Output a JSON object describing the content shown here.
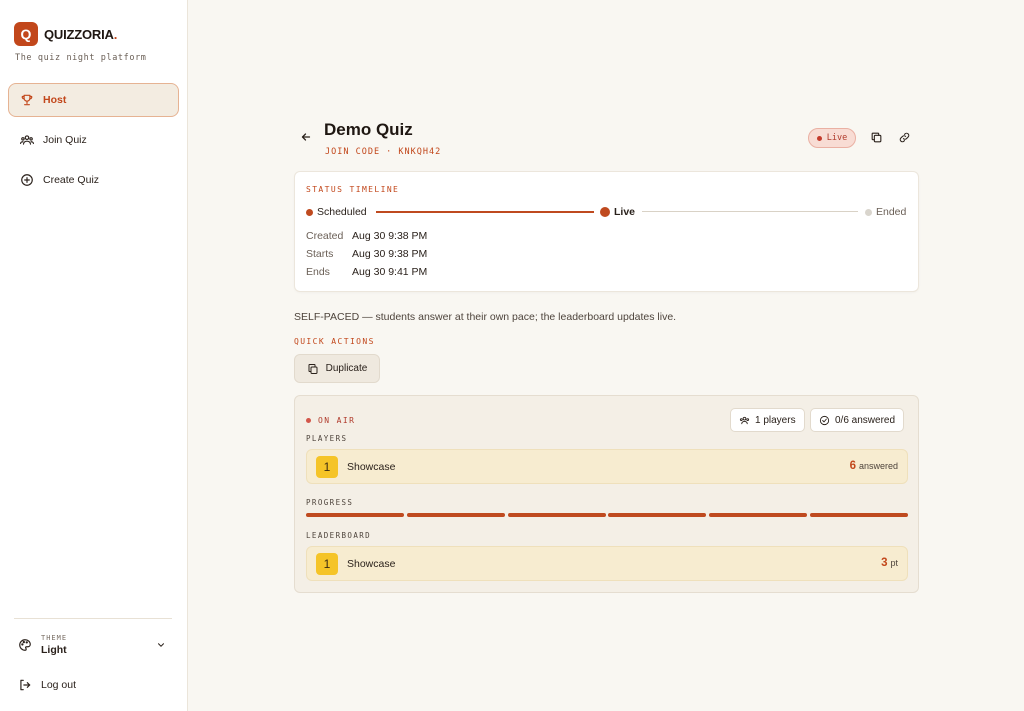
{
  "brand": {
    "logo_letter": "Q",
    "name": "QUIZZORIA",
    "dot": ".",
    "tagline": "The quiz night platform",
    "color": "#c2471b"
  },
  "nav": {
    "items": [
      {
        "label": "Host",
        "icon": "trophy-icon",
        "active": true
      },
      {
        "label": "Join Quiz",
        "icon": "users-icon",
        "active": false
      },
      {
        "label": "Create Quiz",
        "icon": "plus-circle-icon",
        "active": false
      }
    ]
  },
  "theme": {
    "caption": "THEME",
    "value": "Light"
  },
  "logout": {
    "label": "Log out"
  },
  "quiz": {
    "title": "Demo Quiz",
    "join_code": "JOIN CODE · KNKQH42",
    "status_badge": "Live"
  },
  "timeline": {
    "label": "STATUS TIMELINE",
    "stages": [
      "Scheduled",
      "Live",
      "Ended"
    ],
    "current_stage": "Live",
    "dates": [
      {
        "key": "Created",
        "value": "Aug 30 9:38 PM"
      },
      {
        "key": "Starts",
        "value": "Aug 30 9:38 PM"
      },
      {
        "key": "Ends",
        "value": "Aug 30 9:41 PM"
      }
    ]
  },
  "description": "SELF-PACED — students answer at their own pace; the leaderboard updates live.",
  "quick_actions": {
    "label": "QUICK ACTIONS",
    "duplicate_label": "Duplicate"
  },
  "onair": {
    "label": "ON AIR",
    "players_chip": "1 players",
    "answered_chip": "0/6 answered",
    "players_label": "PLAYERS",
    "players": [
      {
        "rank": "1",
        "name": "Showcase",
        "count": "6",
        "unit": "answered"
      }
    ],
    "progress_label": "PROGRESS",
    "progress": {
      "segments_total": 6,
      "segments_filled": 6
    },
    "leaderboard_label": "LEADERBOARD",
    "leaderboard": [
      {
        "rank": "1",
        "name": "Showcase",
        "score": "3",
        "unit": "pt"
      }
    ]
  }
}
